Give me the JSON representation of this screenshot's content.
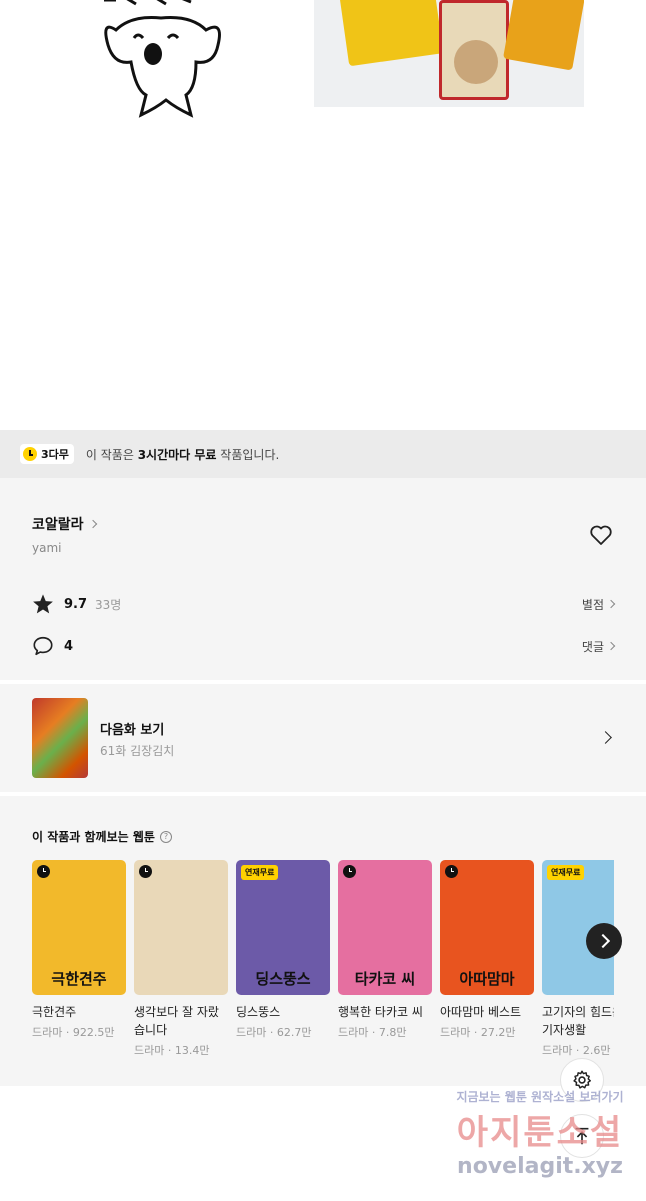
{
  "free_banner": {
    "badge": "3다무",
    "text_prefix": "이 작품은 ",
    "text_bold": "3시간마다 무료",
    "text_suffix": " 작품입니다."
  },
  "work": {
    "title": "코알랄라",
    "author": "yami",
    "rating": "9.7",
    "rating_count": "33명",
    "rating_link": "별점",
    "comment_count": "4",
    "comment_link": "댓글"
  },
  "next_episode": {
    "label": "다음화 보기",
    "episode": "61화 김장김치"
  },
  "recommendations": {
    "title": "이 작품과 함께보는 웹툰",
    "help_icon": "?",
    "items": [
      {
        "name": "극한견주",
        "genre_views": "드라마 · 922.5만",
        "tag": "",
        "cover_text": "극한견주",
        "color": "#f2b92b"
      },
      {
        "name": "생각보다 잘 자랐습니다",
        "genre_views": "드라마 · 13.4만",
        "tag": "",
        "cover_text": "",
        "color": "#e9d8b8"
      },
      {
        "name": "딩스뚱스",
        "genre_views": "드라마 · 62.7만",
        "tag": "연재무료",
        "cover_text": "딩스뚱스",
        "color": "#6c5aa8"
      },
      {
        "name": "행복한 타카코 씨",
        "genre_views": "드라마 · 7.8만",
        "tag": "",
        "cover_text": "타카코 씨",
        "color": "#e56fa0"
      },
      {
        "name": "아따맘마 베스트",
        "genre_views": "드라마 · 27.2만",
        "tag": "",
        "cover_text": "아따맘마",
        "color": "#e8541f"
      },
      {
        "name": "고기자의 힘드운 기자생활",
        "genre_views": "드라마 · 2.6만",
        "tag": "연재무료",
        "cover_text": "",
        "color": "#8fc8e6"
      }
    ]
  },
  "watermark": {
    "line1": "지금보는 웹툰 원작소설 보러가기",
    "line2": "아지툰소설",
    "line3": "novelagit.xyz"
  }
}
